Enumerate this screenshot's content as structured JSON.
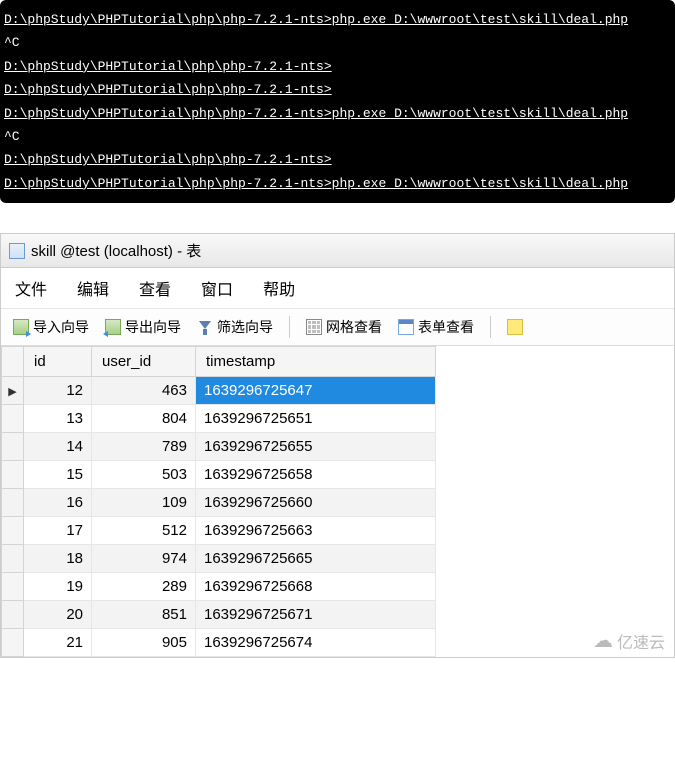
{
  "terminal": {
    "lines": [
      {
        "text": "D:\\phpStudy\\PHPTutorial\\php\\php-7.2.1-nts>php.exe D:\\wwwroot\\test\\skill\\deal.php",
        "underline": true
      },
      {
        "text": "^C",
        "underline": false
      },
      {
        "text": "D:\\phpStudy\\PHPTutorial\\php\\php-7.2.1-nts>",
        "underline": true
      },
      {
        "text": "D:\\phpStudy\\PHPTutorial\\php\\php-7.2.1-nts>",
        "underline": true
      },
      {
        "text": "D:\\phpStudy\\PHPTutorial\\php\\php-7.2.1-nts>php.exe D:\\wwwroot\\test\\skill\\deal.php",
        "underline": true
      },
      {
        "text": "^C",
        "underline": false
      },
      {
        "text": "D:\\phpStudy\\PHPTutorial\\php\\php-7.2.1-nts>",
        "underline": true
      },
      {
        "text": "D:\\phpStudy\\PHPTutorial\\php\\php-7.2.1-nts>php.exe D:\\wwwroot\\test\\skill\\deal.php",
        "underline": true
      }
    ]
  },
  "window": {
    "title": "skill @test (localhost) - 表"
  },
  "menu": {
    "file": "文件",
    "edit": "编辑",
    "view": "查看",
    "window": "窗口",
    "help": "帮助"
  },
  "toolbar": {
    "import": "导入向导",
    "export": "导出向导",
    "filter": "筛选向导",
    "grid": "网格查看",
    "form": "表单查看"
  },
  "table": {
    "headers": {
      "id": "id",
      "user_id": "user_id",
      "timestamp": "timestamp"
    },
    "rows": [
      {
        "id": "12",
        "user_id": "463",
        "timestamp": "1639296725647",
        "selected": true
      },
      {
        "id": "13",
        "user_id": "804",
        "timestamp": "1639296725651"
      },
      {
        "id": "14",
        "user_id": "789",
        "timestamp": "1639296725655"
      },
      {
        "id": "15",
        "user_id": "503",
        "timestamp": "1639296725658"
      },
      {
        "id": "16",
        "user_id": "109",
        "timestamp": "1639296725660"
      },
      {
        "id": "17",
        "user_id": "512",
        "timestamp": "1639296725663"
      },
      {
        "id": "18",
        "user_id": "974",
        "timestamp": "1639296725665"
      },
      {
        "id": "19",
        "user_id": "289",
        "timestamp": "1639296725668"
      },
      {
        "id": "20",
        "user_id": "851",
        "timestamp": "1639296725671"
      },
      {
        "id": "21",
        "user_id": "905",
        "timestamp": "1639296725674"
      }
    ]
  },
  "watermark": {
    "text": "亿速云"
  }
}
